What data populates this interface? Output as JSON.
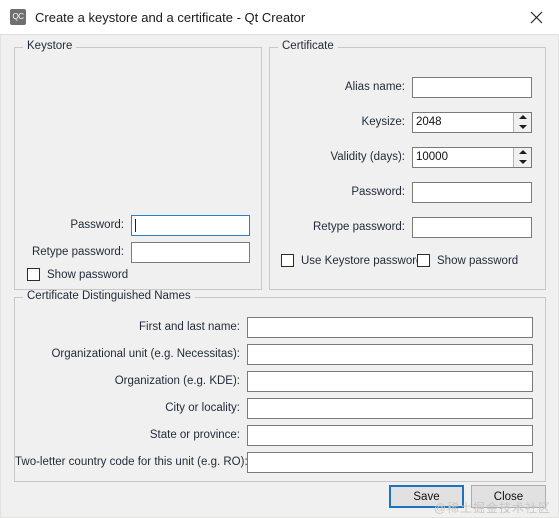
{
  "window": {
    "title": "Create a keystore and a certificate - Qt Creator",
    "icon_label": "QC",
    "close_icon": "close-icon"
  },
  "keystore": {
    "group_title": "Keystore",
    "password_label": "Password:",
    "password_value": "",
    "retype_label": "Retype password:",
    "retype_value": "",
    "show_password_label": "Show password",
    "show_password_checked": false
  },
  "certificate": {
    "group_title": "Certificate",
    "alias_label": "Alias name:",
    "alias_value": "",
    "keysize_label": "Keysize:",
    "keysize_value": "2048",
    "validity_label": "Validity (days):",
    "validity_value": "10000",
    "password_label": "Password:",
    "password_value": "",
    "retype_label": "Retype password:",
    "retype_value": "",
    "use_keystore_password_label": "Use Keystore password",
    "use_keystore_password_checked": false,
    "show_password_label": "Show password",
    "show_password_checked": false
  },
  "distinguished_names": {
    "group_title": "Certificate Distinguished Names",
    "fields": [
      {
        "label": "First and last name:",
        "value": ""
      },
      {
        "label": "Organizational unit (e.g. Necessitas):",
        "value": ""
      },
      {
        "label": "Organization (e.g. KDE):",
        "value": ""
      },
      {
        "label": "City or locality:",
        "value": ""
      },
      {
        "label": "State or province:",
        "value": ""
      },
      {
        "label": "Two-letter country code for this unit (e.g. RO):",
        "value": ""
      }
    ]
  },
  "buttons": {
    "save_label": "Save",
    "close_label": "Close"
  },
  "watermark": {
    "text": "@稀土掘金技术社区"
  },
  "colors": {
    "dialog_background": "#f0f0f0",
    "titlebar_background": "#ffffff",
    "focus_blue": "#1d74bd",
    "field_border": "#7a7a7a",
    "group_border": "#c8c8c8",
    "text": "#1f2a38"
  }
}
